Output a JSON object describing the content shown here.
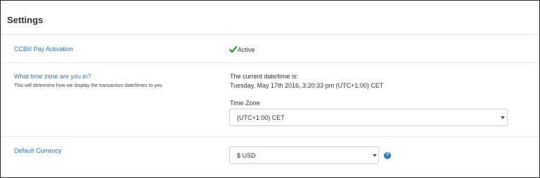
{
  "header": {
    "title": "Settings"
  },
  "settings": {
    "ccbill": {
      "label": "CCBill Pay Activation",
      "status": "Active"
    },
    "timezone": {
      "label": "What time zone are you in?",
      "helper": "This will determine how we display the transaction date/times to you",
      "current_label": "The current date/time is:",
      "current_value": "Tuesday, May 17th 2016, 3:20:33 pm (UTC+1:00) CET",
      "select_label": "Time Zone",
      "selected": "(UTC+1:00) CET"
    },
    "currency": {
      "label": "Default Currency",
      "selected": "$ USD"
    }
  },
  "colors": {
    "link": "#2d77c4",
    "success": "#2e9a2e",
    "border": "#cccccc"
  },
  "icons": {
    "status": "checkmark-icon",
    "help": "question-circle-icon",
    "caret": "chevron-down-icon"
  }
}
